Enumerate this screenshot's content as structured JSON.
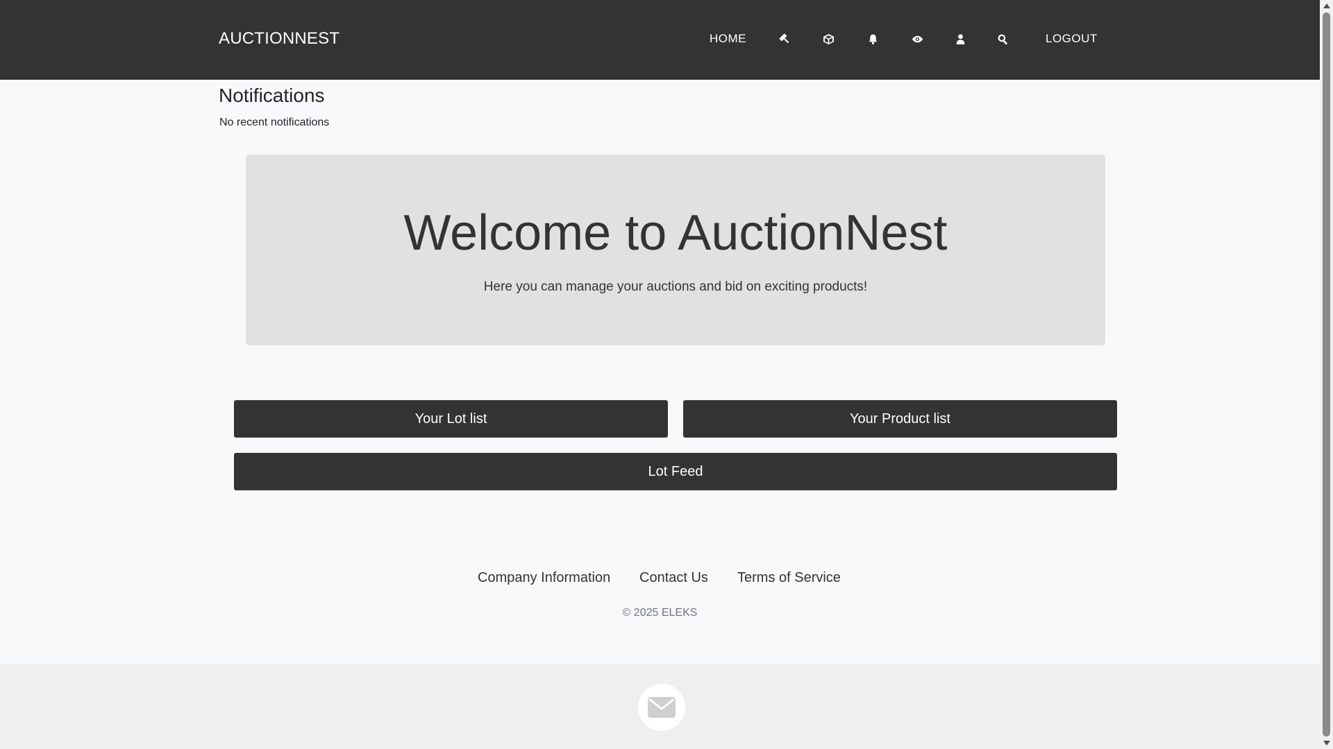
{
  "navbar": {
    "brand": "AUCTIONNEST",
    "home_label": "HOME",
    "logout_label": "LOGOUT",
    "icons": [
      "gavel-icon",
      "cube-icon",
      "bell-icon",
      "eye-icon",
      "user-icon",
      "search-icon"
    ],
    "background": "#333333"
  },
  "notifications": {
    "title": "Notifications",
    "empty_text": "No recent notifications"
  },
  "jumbotron": {
    "title": "Welcome to AuctionNest",
    "subtitle": "Here you can manage your auctions and bid on exciting products!"
  },
  "actions": {
    "lot_list": "Your Lot list",
    "product_list": "Your Product list",
    "lot_feed": "Lot Feed"
  },
  "footer": {
    "links": [
      "Company Information",
      "Contact Us",
      "Terms of Service"
    ],
    "copyright": "© 2025 ELEKS"
  },
  "bottom_band": {
    "icon": "envelope-icon"
  }
}
